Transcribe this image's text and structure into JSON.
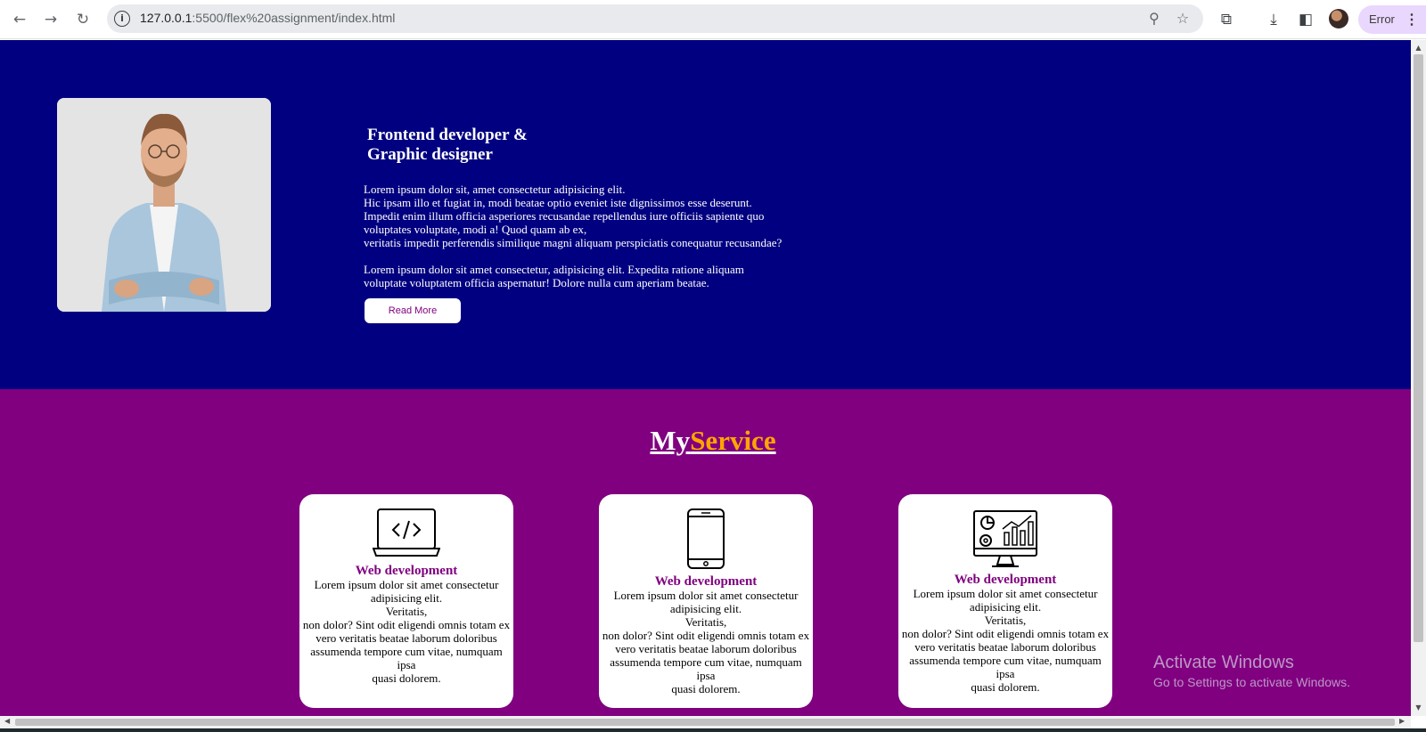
{
  "browser": {
    "url_host": "127.0.0.1",
    "url_path": ":5500/flex%20assignment/index.html",
    "profile_status": "Error"
  },
  "hero": {
    "title_line1": "Frontend developer &",
    "title_line2": "Graphic designer",
    "paragraph1_lines": [
      "Lorem ipsum dolor sit, amet consectetur adipisicing elit.",
      "Hic ipsam illo et fugiat in, modi beatae optio eveniet iste dignissimos esse deserunt.",
      "Impedit enim illum officia asperiores recusandae repellendus iure officiis sapiente quo",
      "voluptates voluptate, modi a! Quod quam ab ex,",
      "veritatis impedit perferendis similique magni aliquam perspiciatis conequatur recusandae?"
    ],
    "paragraph2_lines": [
      "Lorem ipsum dolor sit amet consectetur, adipisicing elit. Expedita ratione aliquam",
      "voluptate voluptatem officia aspernatur! Dolore nulla cum aperiam beatae."
    ],
    "button_label": "Read More"
  },
  "services": {
    "heading_my": "My",
    "heading_service": "Service",
    "cards": [
      {
        "icon": "laptop-code-icon",
        "title": "Web development",
        "text_lines": [
          "Lorem ipsum dolor sit amet consectetur",
          "adipisicing elit.",
          "Veritatis,",
          "non dolor? Sint odit eligendi omnis totam ex",
          "vero veritatis beatae laborum doloribus",
          "assumenda tempore cum vitae, numquam ipsa",
          "quasi dolorem."
        ]
      },
      {
        "icon": "smartphone-icon",
        "title": "Web development",
        "text_lines": [
          "Lorem ipsum dolor sit amet consectetur",
          "adipisicing elit.",
          "Veritatis,",
          "non dolor? Sint odit eligendi omnis totam ex",
          "vero veritatis beatae laborum doloribus",
          "assumenda tempore cum vitae, numquam ipsa",
          "quasi dolorem."
        ]
      },
      {
        "icon": "monitor-analytics-icon",
        "title": "Web development",
        "text_lines": [
          "Lorem ipsum dolor sit amet consectetur",
          "adipisicing elit.",
          "Veritatis,",
          "non dolor? Sint odit eligendi omnis totam ex",
          "vero veritatis beatae laborum doloribus",
          "assumenda tempore cum vitae, numquam ipsa",
          "quasi dolorem."
        ]
      }
    ]
  },
  "watermark": {
    "title": "Activate Windows",
    "subtitle": "Go to Settings to activate Windows."
  },
  "colors": {
    "hero_bg": "#000080",
    "services_bg": "#800080",
    "accent": "#ffa500"
  }
}
